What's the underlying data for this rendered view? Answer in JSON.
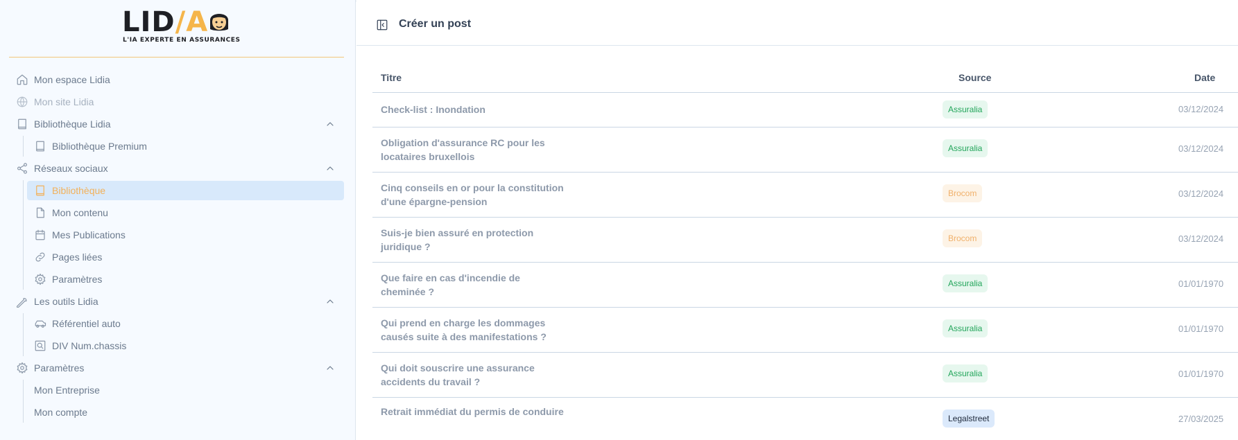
{
  "brand": {
    "logo_text_main": "LID",
    "logo_text_accent": "/A",
    "tagline": "L'IA EXPERTE EN ASSURANCES",
    "accent_color": "#f5b54a"
  },
  "sidebar": {
    "items": [
      {
        "label": "Mon espace Lidia",
        "icon": "home-icon"
      },
      {
        "label": "Mon site Lidia",
        "icon": "globe-icon"
      },
      {
        "label": "Bibliothèque Lidia",
        "icon": "book-icon"
      },
      {
        "label": "Bibliothèque Premium",
        "icon": "book-icon"
      },
      {
        "label": "Réseaux sociaux",
        "icon": "share-icon"
      },
      {
        "label": "Bibliothèque",
        "icon": "book-icon"
      },
      {
        "label": "Mon contenu",
        "icon": "file-icon"
      },
      {
        "label": "Mes Publications",
        "icon": "calendar-icon"
      },
      {
        "label": "Pages liées",
        "icon": "link-icon"
      },
      {
        "label": "Paramètres",
        "icon": "gear-icon"
      },
      {
        "label": "Les outils Lidia",
        "icon": "wrench-icon"
      },
      {
        "label": "Référentiel auto",
        "icon": "car-icon"
      },
      {
        "label": "DIV Num.chassis",
        "icon": "search-box-icon"
      },
      {
        "label": "Paramètres",
        "icon": "gear-icon"
      },
      {
        "label": "Mon Entreprise",
        "icon": ""
      },
      {
        "label": "Mon compte",
        "icon": ""
      }
    ]
  },
  "header": {
    "title": "Créer un post",
    "toggle_icon": "sidebar-collapse-icon"
  },
  "table": {
    "columns": [
      "Titre",
      "Source",
      "Date"
    ],
    "rows": [
      {
        "title": "Check-list : Inondation",
        "source": "Assuralia",
        "date": "03/12/2024"
      },
      {
        "title": "Obligation d'assurance RC pour les locataires bruxellois",
        "source": "Assuralia",
        "date": "03/12/2024"
      },
      {
        "title": "Cinq conseils en or pour la constitution d'une épargne-pension",
        "source": "Brocom",
        "date": "03/12/2024"
      },
      {
        "title": "Suis-je bien assuré en protection juridique ?",
        "source": "Brocom",
        "date": "03/12/2024"
      },
      {
        "title": "Que faire en cas d'incendie de cheminée ?",
        "source": "Assuralia",
        "date": "01/01/1970"
      },
      {
        "title": "Qui prend en charge les dommages causés suite à des manifestations ?",
        "source": "Assuralia",
        "date": "01/01/1970"
      },
      {
        "title": "Qui doit souscrire une assurance accidents du travail ?",
        "source": "Assuralia",
        "date": "01/01/1970"
      },
      {
        "title": "Retrait immédiat du permis de conduire",
        "source": "Legalstreet",
        "date": "27/03/2025"
      }
    ]
  },
  "source_colors": {
    "Assuralia": {
      "bg": "#e6f7ee",
      "fg": "#22a55a"
    },
    "Brocom": {
      "bg": "#fdf3e6",
      "fg": "#f0b06a"
    },
    "Legalstreet": {
      "bg": "#dbe9fb",
      "fg": "#1e293b"
    }
  }
}
